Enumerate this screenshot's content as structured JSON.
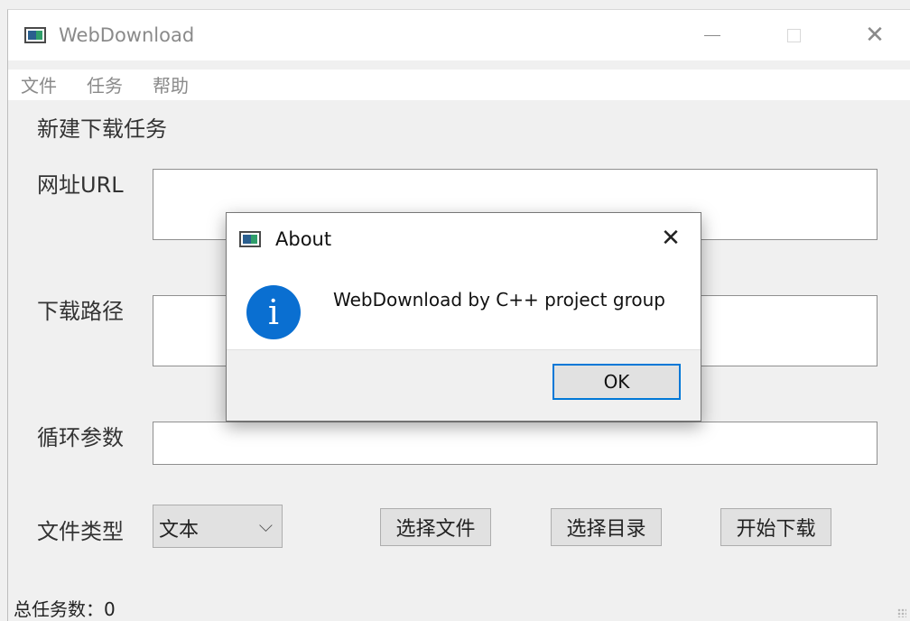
{
  "window": {
    "title": "WebDownload"
  },
  "menu": {
    "items": [
      "文件",
      "任务",
      "帮助"
    ]
  },
  "form": {
    "heading": "新建下载任务",
    "url_label": "网址URL",
    "path_label": "下载路径",
    "loop_label": "循环参数",
    "type_label": "文件类型",
    "type_selected": "文本",
    "select_file_label": "选择文件",
    "select_dir_label": "选择目录",
    "start_label": "开始下载"
  },
  "status": {
    "total_tasks": "总任务数：0"
  },
  "about_dialog": {
    "title": "About",
    "message": "WebDownload by C++ project group",
    "ok_label": "OK"
  },
  "colors": {
    "info_icon": "#0a6fd1",
    "ok_button_border": "#0078d7"
  }
}
